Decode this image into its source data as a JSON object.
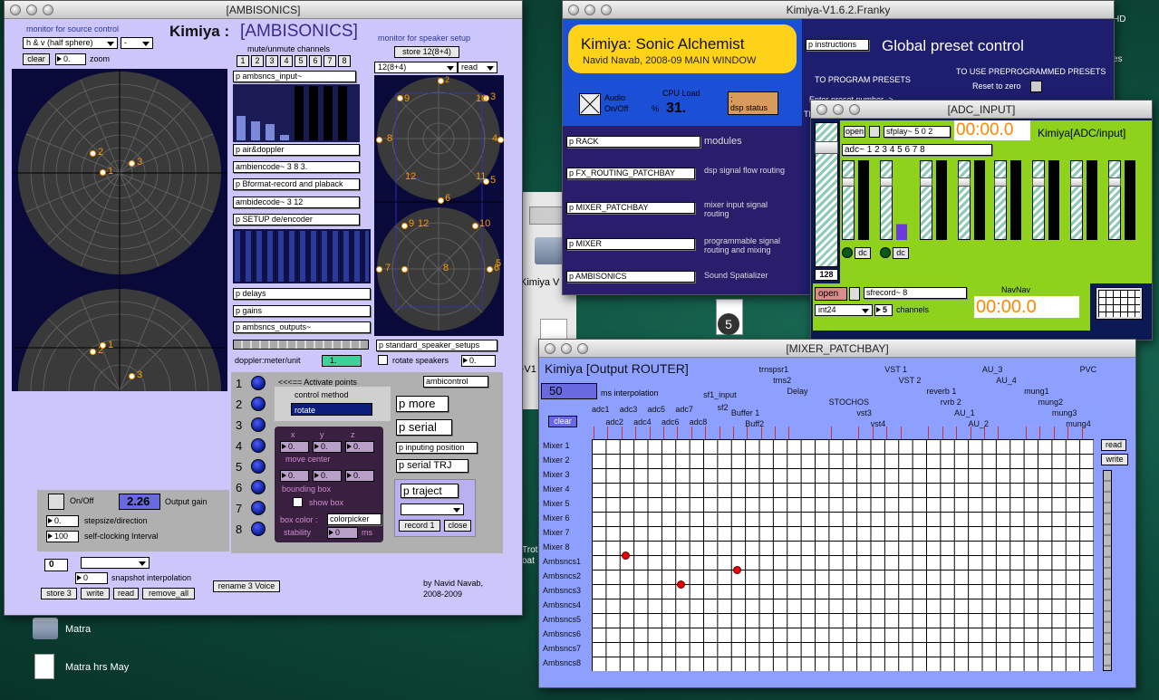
{
  "desktop": {
    "folder_label": "Matra",
    "file_label": "Matra hrs May",
    "partial_labels": [
      "Kimiya V",
      "~V1",
      "Trot",
      "oat"
    ],
    "badge": "5",
    "side_hd": "HD",
    "side_es": "es"
  },
  "ambi": {
    "title": "[AMBISONICS]",
    "heading_prefix": "Kimiya :",
    "heading": "[AMBISONICS]",
    "monitor_src": "monitor for source control",
    "src_menu": "h & v (half sphere)",
    "src_menu2": "-",
    "clear": "clear",
    "zoom_val": "0.",
    "zoom": "zoom",
    "mute_lbl": "mute/unmute channels",
    "channels": [
      "1",
      "2",
      "3",
      "4",
      "5",
      "6",
      "7",
      "8"
    ],
    "plist": [
      "p ambsncs_input~",
      "p air&doppler",
      "ambiencode~ 3 8 3.",
      "p Bformat-record and plaback",
      "ambidecode~ 3 12",
      "p SETUP de/encoder",
      "p delays",
      "p gains",
      "p ambsncs_outputs~"
    ],
    "doppler_lbl": "doppler:meter/unit",
    "doppler_val": "1.",
    "monitor_spk": "monitor for speaker setup",
    "store_btn": "store 12(8+4)",
    "spk_menu": "12(8+4)",
    "spk_read": "read",
    "std_setups": "p standard_speaker_setups",
    "rotate_lbl": "rotate speakers",
    "rotate_val": "0.",
    "src_points": [
      "2",
      "1",
      "3"
    ],
    "spk_top": [
      "2",
      "3",
      "9",
      "10",
      "4",
      "8",
      "12",
      "11",
      "5",
      "6"
    ],
    "spk_bot": [
      "9",
      "12",
      "10",
      "7",
      "8",
      "6",
      "5"
    ],
    "activate_lbl": "<<<== Activate points",
    "ambicontrol": "ambicontrol",
    "control_method": "control method",
    "rotate_menu": "rotate",
    "xyz": [
      "x",
      "y",
      "z"
    ],
    "xyz_vals": [
      "0.",
      "0.",
      "0."
    ],
    "move_center": "move center",
    "bbox_vals": [
      "0.",
      "0.",
      "0."
    ],
    "bbox_lbl": "bounding box",
    "show_box": "show box",
    "box_color": "box color :",
    "colorpicker": "colorpicker",
    "stability": "stability",
    "stab_val": "0",
    "ms": "ms",
    "rows": [
      "1",
      "2",
      "3",
      "4",
      "5",
      "6",
      "7",
      "8"
    ],
    "p_more": "p more",
    "p_serial": "p serial",
    "p_inputing": "p inputing position",
    "p_serial_trj": "p serial TRJ",
    "p_traject": "p traject",
    "record": "record 1",
    "close": "close",
    "onoff": "On/Off",
    "gain_val": "2.26",
    "gain_lbl": "Output gain",
    "step_val": "0.",
    "step_lbl": "stepsize/direction",
    "clock_val": "100",
    "clock_lbl": "self-clocking Interval",
    "snap_val": "0",
    "snap_interp_val": "0",
    "snap_lbl": "snapshot interpolation",
    "rename": "rename 3 Voice",
    "store3": "store 3",
    "write": "write",
    "read": "read",
    "remove_all": "remove_all",
    "credit": "by Navid Navab,",
    "years": "2008-2009"
  },
  "main": {
    "title": "Kimiya-V1.6.2.Franky",
    "banner_title": "Kimiya: Sonic Alchemist",
    "banner_sub": "Navid Navab, 2008-09 MAIN WINDOW",
    "audio_lbl": "Audio",
    "onoff": "On/Off",
    "cpu_lbl": "CPU Load",
    "pct": "%",
    "cpu": "31.",
    "dsp": ";",
    "dsp_status": "dsp status",
    "modules": [
      {
        "p": "p RACK",
        "d": "modules"
      },
      {
        "p": "p FX_ROUTING_PATCHBAY",
        "d": "dsp signal flow routing"
      },
      {
        "p": "p MIXER_PATCHBAY",
        "d": "mixer input signal routing"
      },
      {
        "p": "p MIXER",
        "d": "programmable signal routing and mixing"
      },
      {
        "p": "p AMBISONICS",
        "d": "Sound Spatializer"
      }
    ],
    "instructions": "p instructions",
    "global": "Global preset control",
    "to_program": "TO PROGRAM PRESETS",
    "to_use": "TO USE PREPROGRAMMED PRESETS",
    "reset": "Reset to zero",
    "enter_partial": "Enter preset number ->",
    "the_partial": "The"
  },
  "adc": {
    "title": "[ADC_INPUT]",
    "open": "open",
    "sfplay": "sfplay~ 5 0 2",
    "timer1": "00:00.0",
    "heading": "Kimiya[ADC/input]",
    "adc_obj": "adc~ 1 2 3 4 5 6 7 8",
    "master_val": "128",
    "dc1": "dc",
    "dc2": "dc",
    "open2": "open",
    "sfrecord": "sfrecord~ 8",
    "navnav": "NavNav",
    "int24": "int24",
    "ch_val": "5",
    "channels": "channels",
    "timer2": "00:00.0"
  },
  "router": {
    "title": "[MIXER_PATCHBAY]",
    "heading": "Kimiya [Output ROUTER]",
    "interp_val": "50",
    "interp_lbl": "ms interpolation",
    "clear": "clear",
    "read": "read",
    "write": "write",
    "cols": [
      {
        "t": "adc1",
        "c": 0
      },
      {
        "t": "adc2",
        "c": 1
      },
      {
        "t": "adc3",
        "c": 2
      },
      {
        "t": "adc4",
        "c": 3
      },
      {
        "t": "adc5",
        "c": 4
      },
      {
        "t": "adc6",
        "c": 5
      },
      {
        "t": "adc7",
        "c": 6
      },
      {
        "t": "adc8",
        "c": 7
      },
      {
        "t": "sf1_input",
        "c": 8
      },
      {
        "t": "sf2",
        "c": 9
      },
      {
        "t": "Buffer 1",
        "c": 10
      },
      {
        "t": "Buff2",
        "c": 11
      },
      {
        "t": "trnspsr1",
        "c": 12
      },
      {
        "t": "trns2",
        "c": 13
      },
      {
        "t": "Delay",
        "c": 14
      },
      {
        "t": "STOCHOS",
        "c": 17
      },
      {
        "t": "vst3",
        "c": 19
      },
      {
        "t": "vst4",
        "c": 20
      },
      {
        "t": "VST 1",
        "c": 21
      },
      {
        "t": "VST 2",
        "c": 22
      },
      {
        "t": "reverb 1",
        "c": 24
      },
      {
        "t": "rvrb 2",
        "c": 25
      },
      {
        "t": "AU_1",
        "c": 26
      },
      {
        "t": "AU_2",
        "c": 27
      },
      {
        "t": "AU_3",
        "c": 28
      },
      {
        "t": "AU_4",
        "c": 29
      },
      {
        "t": "mung1",
        "c": 31
      },
      {
        "t": "mung2",
        "c": 32
      },
      {
        "t": "mung3",
        "c": 33
      },
      {
        "t": "mung4",
        "c": 34
      },
      {
        "t": "PVC",
        "c": 35
      }
    ],
    "rows": [
      "Mixer 1",
      "Mixer 2",
      "Mixer 3",
      "Mixer 4",
      "Mixer 5",
      "Mixer 6",
      "Mixer 7",
      "Mixer 8",
      "Ambsncs1",
      "Ambsncs2",
      "Ambsncs3",
      "Ambsncs4",
      "Ambsncs5",
      "Ambsncs6",
      "Ambsncs7",
      "Ambsncs8"
    ],
    "active": [
      [
        8,
        1
      ],
      [
        9,
        5
      ],
      [
        10,
        3
      ]
    ]
  },
  "finder": {
    "partial": "Kimiya V"
  }
}
